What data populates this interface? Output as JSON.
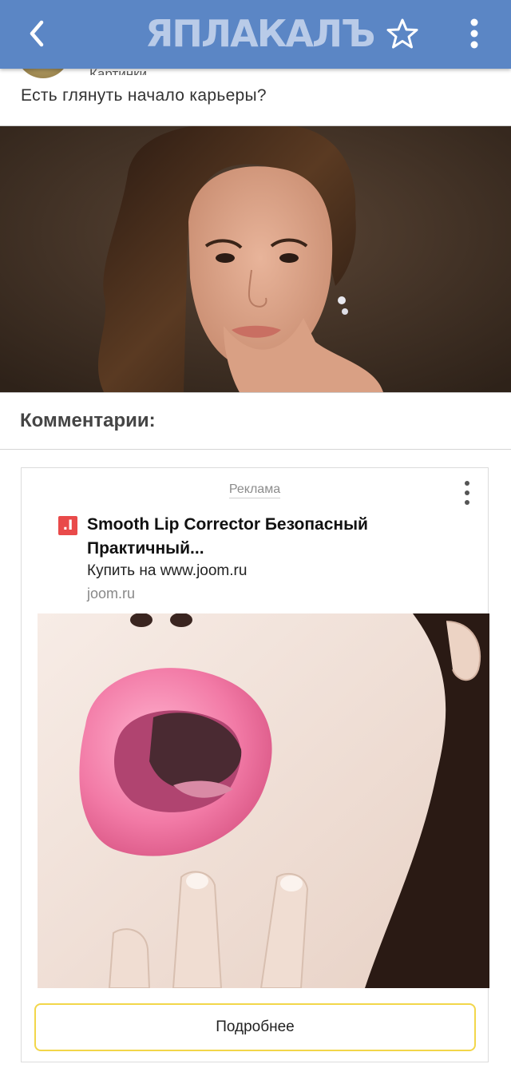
{
  "header": {
    "logo_text": "ЯПЛАКАЛЪ",
    "back_icon": "back-chevron-icon",
    "favorite_icon": "star-outline-icon",
    "menu_icon": "vertical-dots-icon",
    "brand_color": "#5b86c5"
  },
  "post": {
    "category": "Картинки",
    "title": "Есть глянуть начало карьеры?"
  },
  "comments": {
    "heading": "Комментарии:"
  },
  "ad": {
    "label": "Реклама",
    "favicon_glyph": ".I",
    "headline": "Smooth Lip Corrector Безопасный Практичный...",
    "description": "Купить на www.joom.ru",
    "domain": "joom.ru",
    "button_label": "Подробнее",
    "button_border_color": "#f2d64a"
  }
}
